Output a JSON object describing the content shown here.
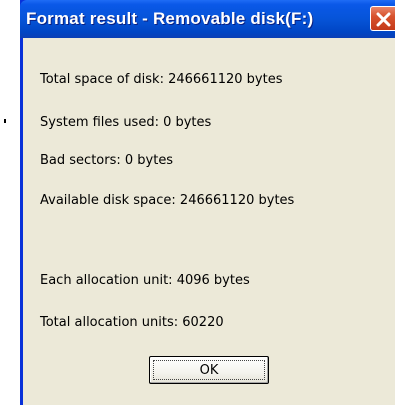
{
  "window": {
    "title": "Format result - Removable disk(F:)"
  },
  "title_bar": {
    "close_icon": "close-x-icon",
    "close_color": "#d8532e",
    "bar_color": "#0654d8"
  },
  "results": {
    "total_space": "Total space of disk: 246661120 bytes",
    "system_files": "System files used: 0 bytes",
    "bad_sectors": "Bad sectors: 0 bytes",
    "available_space": "Available disk space: 246661120 bytes",
    "allocation_unit": "Each allocation unit: 4096 bytes",
    "allocation_units_total": "Total allocation units: 60220"
  },
  "buttons": {
    "ok_label": "OK"
  }
}
